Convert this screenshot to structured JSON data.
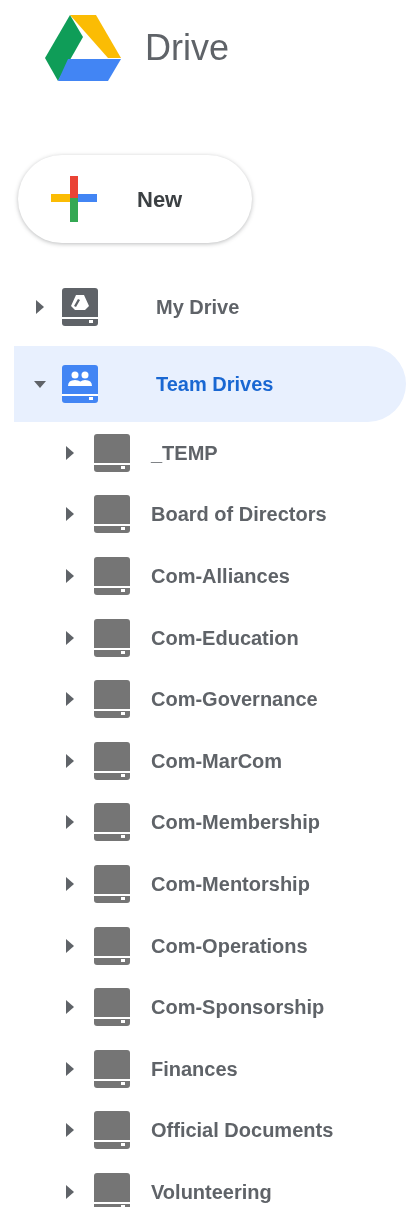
{
  "app": {
    "title": "Drive"
  },
  "new_button": {
    "label": "New"
  },
  "nav": [
    {
      "kind": "personal",
      "label": "My Drive",
      "expanded": false,
      "selected": false
    },
    {
      "kind": "team",
      "label": "Team Drives",
      "expanded": true,
      "selected": true,
      "children": [
        {
          "kind": "drive",
          "label": "_TEMP",
          "expanded": false,
          "selected": false
        },
        {
          "kind": "drive",
          "label": "Board of Directors",
          "expanded": false,
          "selected": false
        },
        {
          "kind": "drive",
          "label": "Com-Alliances",
          "expanded": false,
          "selected": false
        },
        {
          "kind": "drive",
          "label": "Com-Education",
          "expanded": false,
          "selected": false
        },
        {
          "kind": "drive",
          "label": "Com-Governance",
          "expanded": false,
          "selected": false
        },
        {
          "kind": "drive",
          "label": "Com-MarCom",
          "expanded": false,
          "selected": false
        },
        {
          "kind": "drive",
          "label": "Com-Membership",
          "expanded": false,
          "selected": false
        },
        {
          "kind": "drive",
          "label": "Com-Mentorship",
          "expanded": false,
          "selected": false
        },
        {
          "kind": "drive",
          "label": "Com-Operations",
          "expanded": false,
          "selected": false
        },
        {
          "kind": "drive",
          "label": "Com-Sponsorship",
          "expanded": false,
          "selected": false
        },
        {
          "kind": "drive",
          "label": "Finances",
          "expanded": false,
          "selected": false
        },
        {
          "kind": "drive",
          "label": "Official Documents",
          "expanded": false,
          "selected": false
        },
        {
          "kind": "drive",
          "label": "Volunteering",
          "expanded": false,
          "selected": false
        }
      ]
    }
  ]
}
